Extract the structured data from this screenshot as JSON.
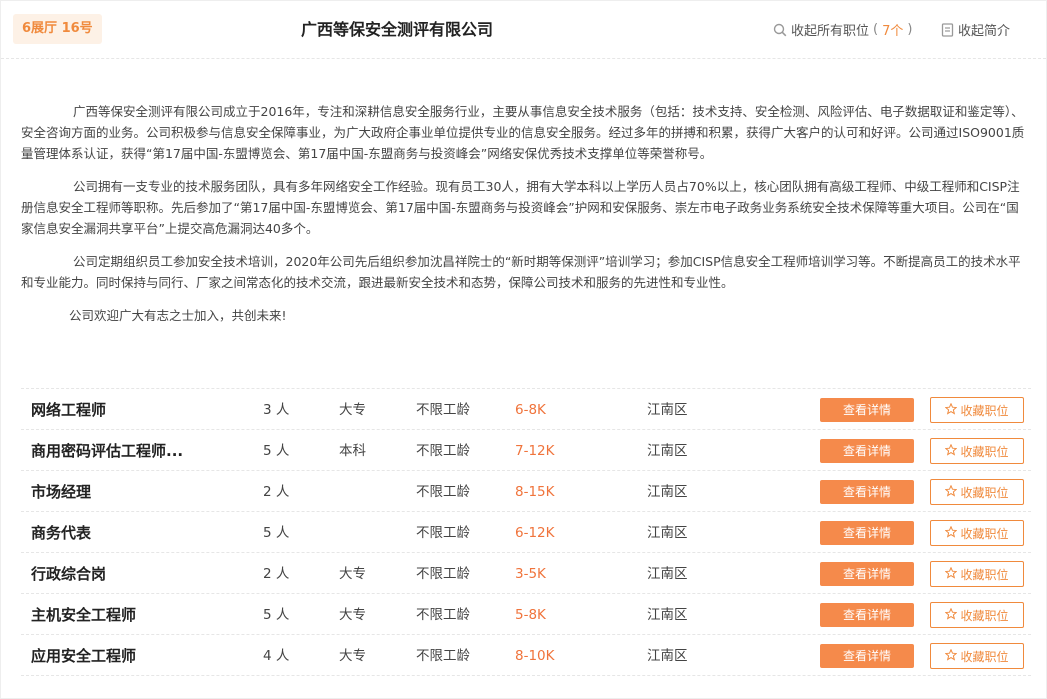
{
  "header": {
    "booth": "6展厅 16号",
    "company": "广西等保安全测评有限公司",
    "collapse_jobs_label": "收起所有职位",
    "open_paren": "(",
    "job_count": "7个",
    "close_paren": ")",
    "collapse_intro_label": "收起简介",
    "icons": {
      "search": "search-icon",
      "doc": "document-icon"
    }
  },
  "intro": {
    "paragraphs": [
      "广西等保安全测评有限公司成立于2016年，专注和深耕信息安全服务行业，主要从事信息安全技术服务（包括：技术支持、安全检测、风险评估、电子数据取证和鉴定等）、安全咨询方面的业务。公司积极参与信息安全保障事业，为广大政府企事业单位提供专业的信息安全服务。经过多年的拼搏和积累，获得广大客户的认可和好评。公司通过ISO9001质量管理体系认证，获得“第17届中国-东盟博览会、第17届中国-东盟商务与投资峰会”网络安保优秀技术支撑单位等荣誉称号。",
      "公司拥有一支专业的技术服务团队，具有多年网络安全工作经验。现有员工30人，拥有大学本科以上学历人员占70%以上，核心团队拥有高级工程师、中级工程师和CISP注册信息安全工程师等职称。先后参加了“第17届中国-东盟博览会、第17届中国-东盟商务与投资峰会”护网和安保服务、崇左市电子政务业务系统安全技术保障等重大项目。公司在“国家信息安全漏洞共享平台”上提交高危漏洞达40多个。",
      "公司定期组织员工参加安全技术培训，2020年公司先后组织参加沈昌祥院士的“新时期等保测评”培训学习；参加CISP信息安全工程师培训学习等。不断提高员工的技术水平和专业能力。同时保持与同行、厂家之间常态化的技术交流，跟进最新安全技术和态势，保障公司技术和服务的先进性和专业性。",
      "公司欢迎广大有志之士加入，共创未来!"
    ]
  },
  "buttons": {
    "detail": "查看详情",
    "favorite": "收藏职位"
  },
  "colors": {
    "accent": "#f58a4b",
    "salary": "#f0743c",
    "booth_bg": "#fdf1e6"
  },
  "jobs": [
    {
      "title": "网络工程师",
      "headcount": "3 人",
      "education": "大专",
      "experience": "不限工龄",
      "salary": "6-8K",
      "location": "江南区"
    },
    {
      "title": "商用密码评估工程师...",
      "headcount": "5 人",
      "education": "本科",
      "experience": "不限工龄",
      "salary": "7-12K",
      "location": "江南区"
    },
    {
      "title": "市场经理",
      "headcount": "2 人",
      "education": "",
      "experience": "不限工龄",
      "salary": "8-15K",
      "location": "江南区"
    },
    {
      "title": "商务代表",
      "headcount": "5 人",
      "education": "",
      "experience": "不限工龄",
      "salary": "6-12K",
      "location": "江南区"
    },
    {
      "title": "行政综合岗",
      "headcount": "2 人",
      "education": "大专",
      "experience": "不限工龄",
      "salary": "3-5K",
      "location": "江南区"
    },
    {
      "title": "主机安全工程师",
      "headcount": "5 人",
      "education": "大专",
      "experience": "不限工龄",
      "salary": "5-8K",
      "location": "江南区"
    },
    {
      "title": "应用安全工程师",
      "headcount": "4 人",
      "education": "大专",
      "experience": "不限工龄",
      "salary": "8-10K",
      "location": "江南区"
    }
  ]
}
